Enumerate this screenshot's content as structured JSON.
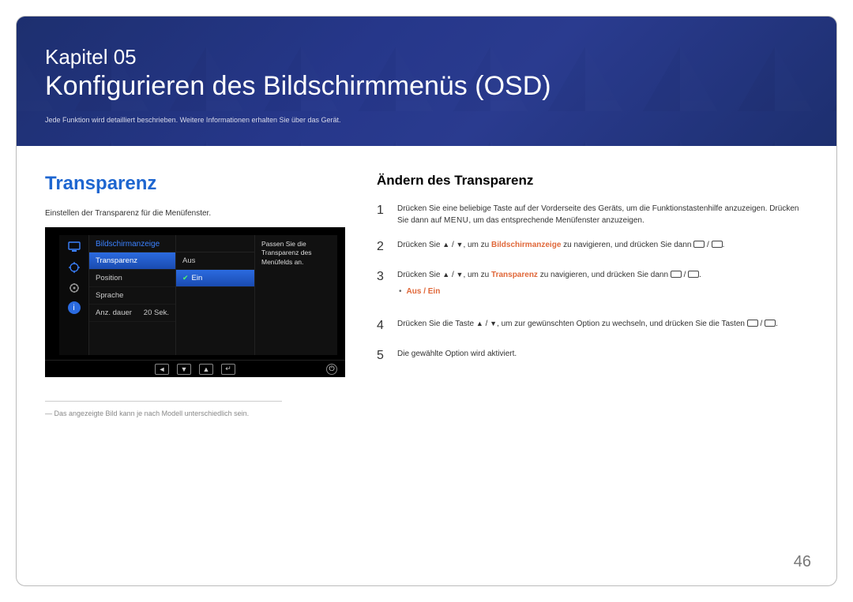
{
  "hero": {
    "chapter": "Kapitel 05",
    "title": "Konfigurieren des Bildschirmmenüs (OSD)",
    "sub": "Jede Funktion wird detailliert beschrieben. Weitere Informationen erhalten Sie über das Gerät."
  },
  "left": {
    "heading": "Transparenz",
    "desc": "Einstellen der Transparenz für die Menüfenster.",
    "osd": {
      "section_title": "Bildschirmanzeige",
      "menu_items": [
        {
          "label": "Transparenz",
          "value": ""
        },
        {
          "label": "Position",
          "value": ""
        },
        {
          "label": "Sprache",
          "value": ""
        },
        {
          "label": "Anz. dauer",
          "value": "20 Sek."
        }
      ],
      "options": [
        {
          "label": "Aus",
          "checked": false
        },
        {
          "label": "Ein",
          "checked": true
        }
      ],
      "hint": "Passen Sie die Transparenz des Menüfelds an."
    },
    "footnote": "Das angezeigte Bild kann je nach Modell unterschiedlich sein."
  },
  "right": {
    "heading": "Ändern des Transparenz",
    "steps": {
      "s1a": "Drücken Sie eine beliebige Taste auf der Vorderseite des Geräts, um die Funktionstastenhilfe anzuzeigen. Drücken Sie dann auf ",
      "s1_menu": "MENU",
      "s1b": ", um das entsprechende Menüfenster anzuzeigen.",
      "s2a": "Drücken Sie ",
      "s2_nav": "Bildschirmanzeige",
      "s2b": " zu navigieren, und drücken Sie dann ",
      "s3_nav": "Transparenz",
      "bullet_aus": "Aus",
      "bullet_slash": " / ",
      "bullet_ein": "Ein",
      "s4a": "Drücken Sie die Taste ",
      "s4b": ", um zur gewünschten Option zu wechseln, und drücken Sie die Tasten ",
      "s5": "Die gewählte Option wird aktiviert.",
      "umzu": ", um zu "
    }
  },
  "page_number": "46"
}
